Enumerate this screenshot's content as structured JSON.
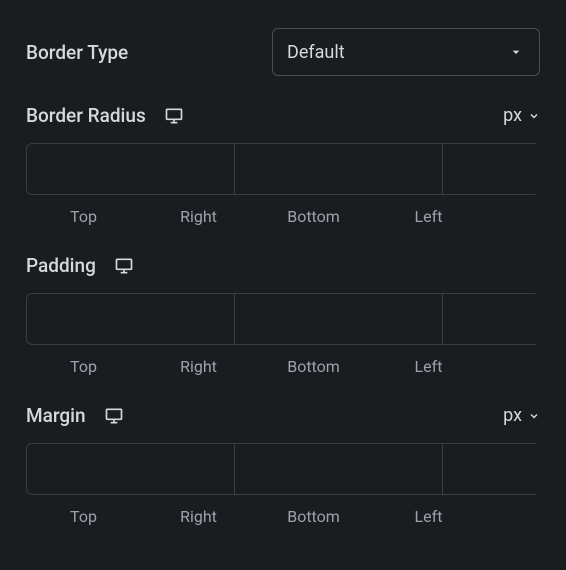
{
  "borderType": {
    "label": "Border Type",
    "value": "Default"
  },
  "sections": {
    "borderRadius": {
      "label": "Border Radius",
      "unit": "px",
      "showUnit": true
    },
    "padding": {
      "label": "Padding",
      "showUnit": false
    },
    "margin": {
      "label": "Margin",
      "unit": "px",
      "showUnit": true
    }
  },
  "sides": {
    "top": "Top",
    "right": "Right",
    "bottom": "Bottom",
    "left": "Left"
  }
}
